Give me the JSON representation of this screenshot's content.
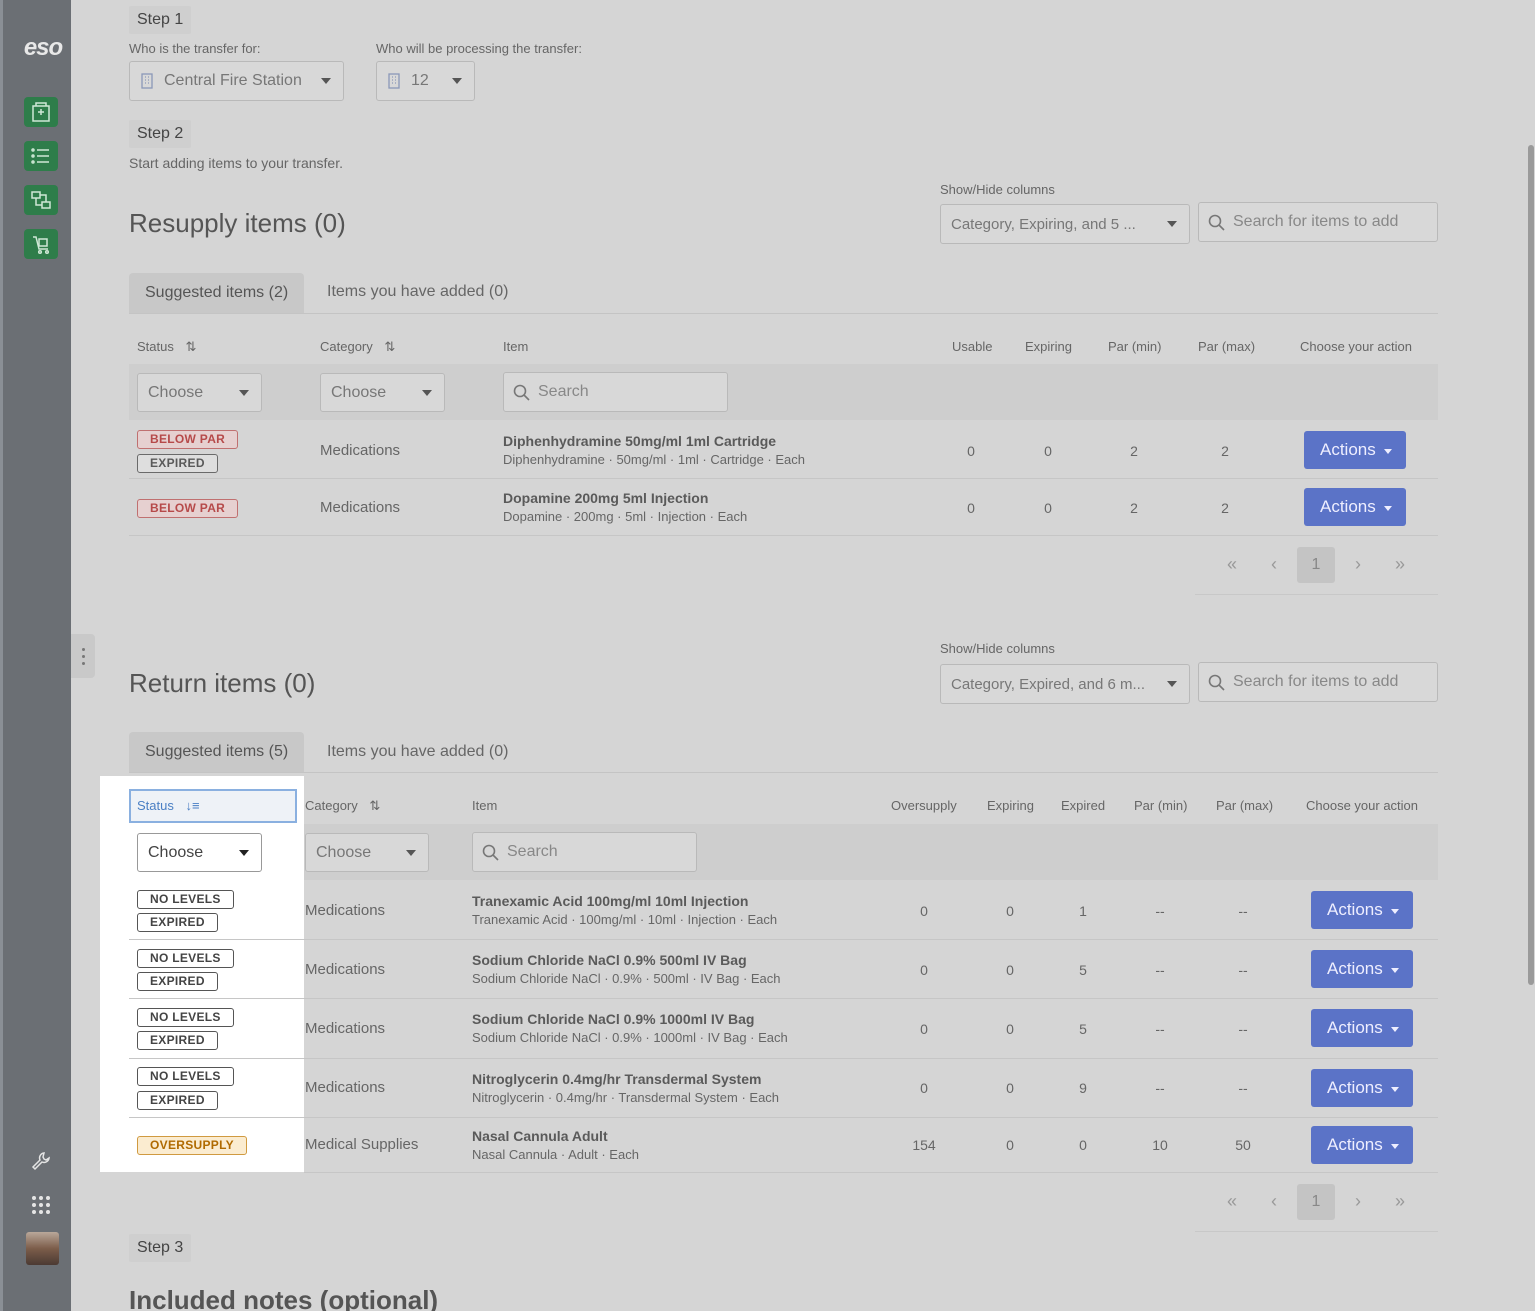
{
  "brand": {
    "logo": "eso"
  },
  "step1": {
    "label": "Step 1",
    "for_label": "Who is the transfer for:",
    "for_value": "Central Fire Station",
    "processing_label": "Who will be processing the transfer:",
    "processing_value": "12"
  },
  "step2": {
    "label": "Step 2",
    "description": "Start adding items to your transfer."
  },
  "resupply": {
    "title": "Resupply items (0)",
    "show_hide_label": "Show/Hide columns",
    "columns_value": "Category, Expiring, and 5 ...",
    "search_placeholder": "Search for items to add",
    "tab_suggested": "Suggested items (2)",
    "tab_added": "Items you have added (0)",
    "headers": {
      "status": "Status",
      "category": "Category",
      "item": "Item",
      "usable": "Usable",
      "expiring": "Expiring",
      "par_min": "Par (min)",
      "par_max": "Par (max)",
      "action": "Choose your action"
    },
    "filter_choose": "Choose",
    "filter_search": "Search",
    "rows": [
      {
        "badges": [
          "BELOW PAR",
          "EXPIRED"
        ],
        "category": "Medications",
        "name": "Diphenhydramine 50mg/ml 1ml Cartridge",
        "desc": "Diphenhydramine · 50mg/ml · 1ml · Cartridge · Each",
        "usable": "0",
        "expiring": "0",
        "par_min": "2",
        "par_max": "2",
        "action": "Actions"
      },
      {
        "badges": [
          "BELOW PAR"
        ],
        "category": "Medications",
        "name": "Dopamine 200mg 5ml Injection",
        "desc": "Dopamine · 200mg · 5ml · Injection · Each",
        "usable": "0",
        "expiring": "0",
        "par_min": "2",
        "par_max": "2",
        "action": "Actions"
      }
    ],
    "pager": {
      "first": "«",
      "prev": "‹",
      "current": "1",
      "next": "›",
      "last": "»"
    }
  },
  "returns": {
    "title": "Return items (0)",
    "show_hide_label": "Show/Hide columns",
    "columns_value": "Category, Expired, and 6 m...",
    "search_placeholder": "Search for items to add",
    "tab_suggested": "Suggested items (5)",
    "tab_added": "Items you have added (0)",
    "headers": {
      "status": "Status",
      "category": "Category",
      "item": "Item",
      "oversupply": "Oversupply",
      "expiring": "Expiring",
      "expired": "Expired",
      "par_min": "Par (min)",
      "par_max": "Par (max)",
      "action": "Choose your action"
    },
    "filter_choose": "Choose",
    "filter_search": "Search",
    "rows": [
      {
        "badges": [
          "NO LEVELS",
          "EXPIRED"
        ],
        "category": "Medications",
        "name": "Tranexamic Acid 100mg/ml 10ml Injection",
        "desc": "Tranexamic Acid · 100mg/ml · 10ml · Injection · Each",
        "oversupply": "0",
        "expiring": "0",
        "expired": "1",
        "par_min": "--",
        "par_max": "--",
        "action": "Actions"
      },
      {
        "badges": [
          "NO LEVELS",
          "EXPIRED"
        ],
        "category": "Medications",
        "name": "Sodium Chloride NaCl 0.9% 500ml IV Bag",
        "desc": "Sodium Chloride NaCl · 0.9% · 500ml · IV Bag · Each",
        "oversupply": "0",
        "expiring": "0",
        "expired": "5",
        "par_min": "--",
        "par_max": "--",
        "action": "Actions"
      },
      {
        "badges": [
          "NO LEVELS",
          "EXPIRED"
        ],
        "category": "Medications",
        "name": "Sodium Chloride NaCl 0.9% 1000ml IV Bag",
        "desc": "Sodium Chloride NaCl · 0.9% · 1000ml · IV Bag · Each",
        "oversupply": "0",
        "expiring": "0",
        "expired": "5",
        "par_min": "--",
        "par_max": "--",
        "action": "Actions"
      },
      {
        "badges": [
          "NO LEVELS",
          "EXPIRED"
        ],
        "category": "Medications",
        "name": "Nitroglycerin 0.4mg/hr Transdermal System",
        "desc": "Nitroglycerin · 0.4mg/hr · Transdermal System · Each",
        "oversupply": "0",
        "expiring": "0",
        "expired": "9",
        "par_min": "--",
        "par_max": "--",
        "action": "Actions"
      },
      {
        "badges": [
          "OVERSUPPLY"
        ],
        "category": "Medical Supplies",
        "name": "Nasal Cannula Adult",
        "desc": "Nasal Cannula · Adult · Each",
        "oversupply": "154",
        "expiring": "0",
        "expired": "0",
        "par_min": "10",
        "par_max": "50",
        "action": "Actions"
      }
    ],
    "pager": {
      "first": "«",
      "prev": "‹",
      "current": "1",
      "next": "›",
      "last": "»"
    }
  },
  "step3": {
    "label": "Step 3",
    "notes_title": "Included notes (optional)"
  },
  "colors": {
    "primary_button": "#5b73c7",
    "sidebar": "#6b6f74",
    "nav_green": "#2e7d4a"
  }
}
